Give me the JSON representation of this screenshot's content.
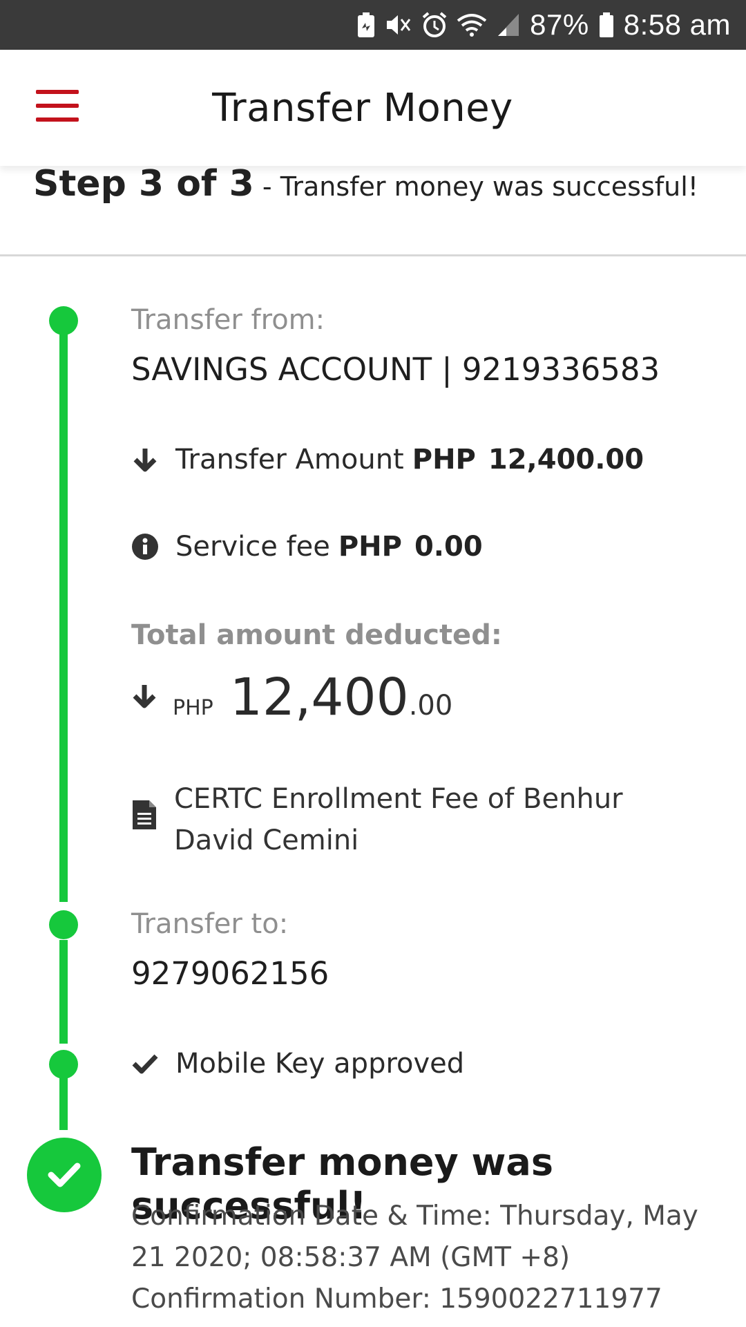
{
  "status_bar": {
    "battery": "87%",
    "time": "8:58 am"
  },
  "header": {
    "title": "Transfer Money"
  },
  "step": {
    "step_label": "Step 3 of 3",
    "step_message": "- Transfer money was successful!"
  },
  "transfer_from": {
    "label": "Transfer from:",
    "account": "SAVINGS ACCOUNT | 9219336583"
  },
  "transfer_amount": {
    "label": "Transfer Amount",
    "currency": "PHP",
    "amount": "12,400.00"
  },
  "service_fee": {
    "label": "Service fee",
    "currency": "PHP",
    "amount": "0.00"
  },
  "total": {
    "label": "Total amount deducted:",
    "currency": "PHP",
    "whole": "12,400",
    "decimal": ".00"
  },
  "remarks": {
    "text": "CERTC Enrollment Fee of Benhur David Cemini"
  },
  "transfer_to": {
    "label": "Transfer to:",
    "number": "9279062156"
  },
  "mobile_key": {
    "label": "Mobile Key approved"
  },
  "result": {
    "title": "Transfer money was successful!",
    "date_line": "Confirmation Date & Time: Thursday, May 21 2020; 08:58:37 AM (GMT +8)",
    "number_line": "Confirmation Number: 1590022711977"
  },
  "colors": {
    "brand_red": "#c3121c",
    "success_green": "#16c83c"
  },
  "icons": {
    "menu": "hamburger-menu-icon",
    "arrow_down": "arrow-down-icon",
    "info": "info-icon",
    "document": "document-icon",
    "check": "check-icon"
  }
}
